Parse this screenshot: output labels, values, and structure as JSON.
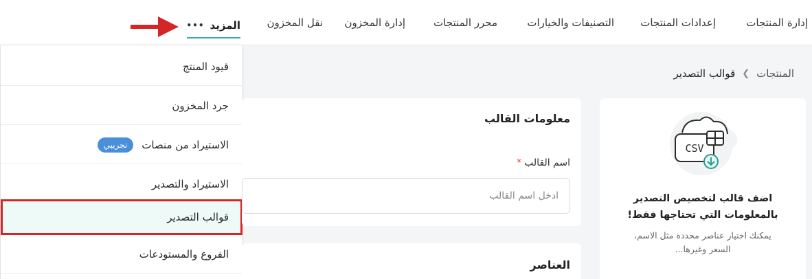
{
  "nav": {
    "items": [
      "إدارة المنتجات",
      "إعدادات المنتجات",
      "التصنيفات والخيارات",
      "محرر المنتجات",
      "إدارة المخزون",
      "نقل المخزون"
    ],
    "more_label": "المزيد",
    "more_icon": "more-dots-icon",
    "accent": "#3aa8a0"
  },
  "annotation": {
    "arrow_color": "#d42626"
  },
  "dropdown": {
    "items": [
      {
        "label": "قيود المنتج"
      },
      {
        "label": "جرد المخزون"
      },
      {
        "label": "الاستيراد من منصات",
        "badge": "تجريبي"
      },
      {
        "label": "الاستيراد والتصدير"
      },
      {
        "label": "قوالب التصدير",
        "active": true
      },
      {
        "label": "الفروع والمستودعات"
      }
    ],
    "highlight_color": "#d42626",
    "badge_color": "#4a90d9"
  },
  "breadcrumb": {
    "parent": "المنتجات",
    "current": "قوالب التصدير"
  },
  "template_info": {
    "title": "معلومات القالب",
    "name_label": "اسم القالب",
    "required_mark": "*",
    "name_placeholder": "ادخل اسم القالب",
    "name_value": ""
  },
  "elements": {
    "title": "العناصر"
  },
  "promo": {
    "icon": "csv-download-icon",
    "illustration_text": "CSV",
    "heading_line1": "اضف قالب لتخصيص التصدير",
    "heading_line2": "بالمعلومات التي تحتاجها فقط!",
    "sub_line1": "يمكنك اختيار عناصر محددة مثل الاسم،",
    "sub_line2": "السعر وغيرها..."
  }
}
